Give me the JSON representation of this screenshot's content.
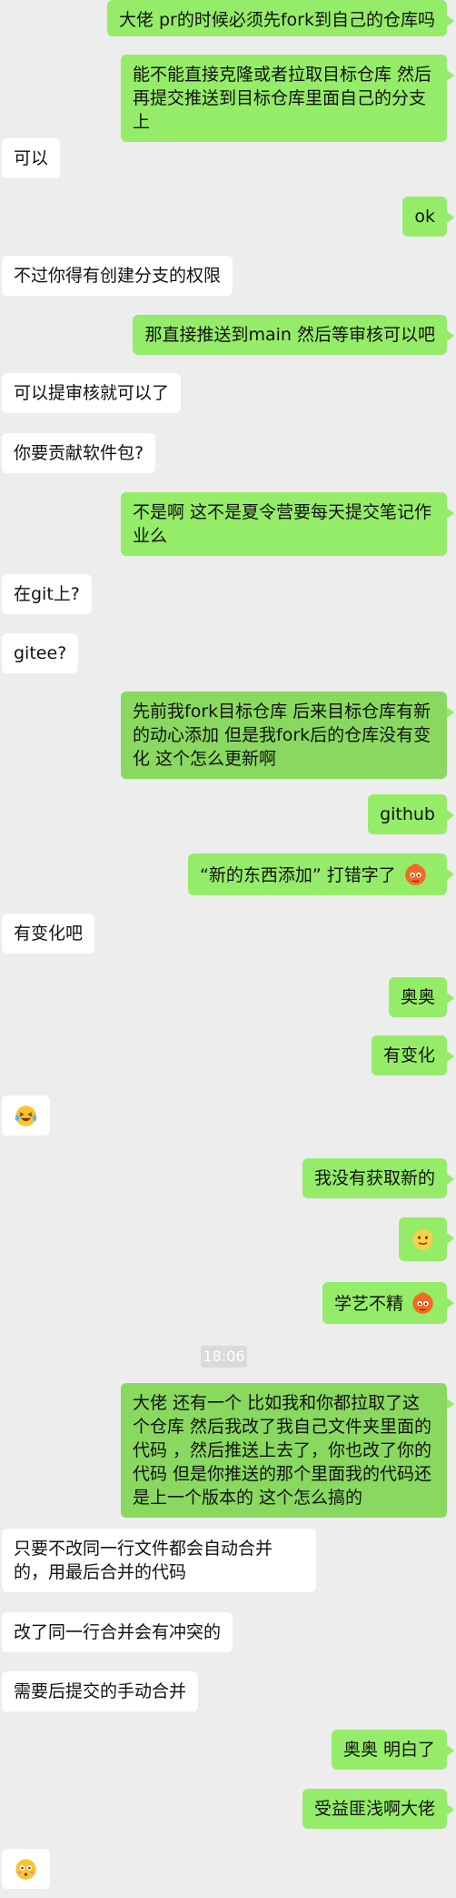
{
  "messages": [
    {
      "side": "out",
      "text": "大佬 pr的时候必须先fork到自己的仓库吗"
    },
    {
      "side": "out",
      "text": "能不能直接克隆或者拉取目标仓库 然后再提交推送到目标仓库里面自己的分支上"
    },
    {
      "side": "in",
      "text": "可以"
    },
    {
      "side": "out",
      "text": "ok"
    },
    {
      "side": "in",
      "text": "不过你得有创建分支的权限"
    },
    {
      "side": "out",
      "text": "那直接推送到main 然后等审核可以吧"
    },
    {
      "side": "in",
      "text": "可以提审核就可以了"
    },
    {
      "side": "in",
      "text": "你要贡献软件包?"
    },
    {
      "side": "out",
      "text": "不是啊 这不是夏令营要每天提交笔记作业么"
    },
    {
      "side": "in",
      "text": "在git上?"
    },
    {
      "side": "in",
      "text": "gitee?"
    },
    {
      "side": "out",
      "text": "先前我fork目标仓库  后来目标仓库有新的动心添加  但是我fork后的仓库没有变化 这个怎么更新啊"
    },
    {
      "side": "out",
      "text": "github"
    },
    {
      "side": "out",
      "text": "“新的东西添加”    打错字了",
      "emoji": "fire-face"
    },
    {
      "side": "in",
      "text": "有变化吧"
    },
    {
      "side": "out",
      "text": "奥奥"
    },
    {
      "side": "out",
      "text": "有变化"
    },
    {
      "side": "in",
      "text": "",
      "emoji": "laughing-tears"
    },
    {
      "side": "out",
      "text": "我没有获取新的"
    },
    {
      "side": "out",
      "text": "",
      "emoji": "smile"
    },
    {
      "side": "out",
      "text": "学艺不精",
      "emoji": "fire-face"
    },
    {
      "side": "out",
      "text": "大佬 还有一个   比如我和你都拉取了这个仓库  然后我改了我自己文件夹里面的代码 ，然后推送上去了，你也改了你的代码 但是你推送的那个里面我的代码还是上一个版本的     这个怎么搞的"
    },
    {
      "side": "in",
      "text": "只要不改同一行文件都会自动合并的，用最后合并的代码"
    },
    {
      "side": "in",
      "text": "改了同一行合并会有冲突的"
    },
    {
      "side": "in",
      "text": "需要后提交的手动合并"
    },
    {
      "side": "out",
      "text": "奥奥 明白了"
    },
    {
      "side": "out",
      "text": "受益匪浅啊大佬"
    },
    {
      "side": "in",
      "text": "",
      "emoji": "flushed"
    }
  ],
  "timestamp": "18:06",
  "colors": {
    "background": "#ededed",
    "outgoing_bubble": "#95ec69",
    "incoming_bubble": "#ffffff",
    "timestamp_bg": "#dadada"
  }
}
